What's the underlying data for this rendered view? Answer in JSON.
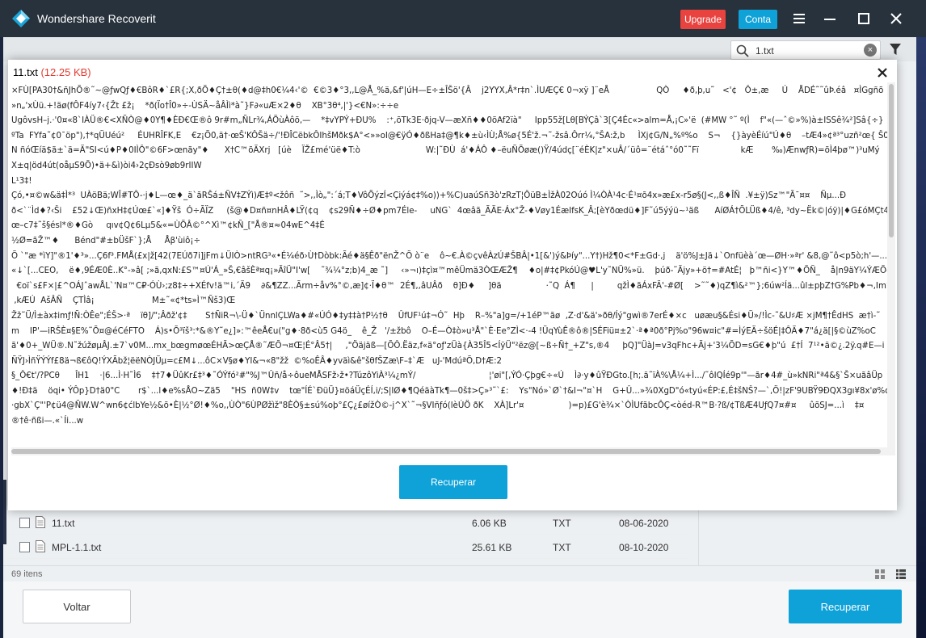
{
  "window": {
    "title": "Wondershare Recoverit",
    "upgrade_label": "Upgrade",
    "account_label": "Conta",
    "accent_blue": "#0fa2d8",
    "upgrade_red": "#e8433f"
  },
  "toolbar": {
    "search_value": "1.txt"
  },
  "preview": {
    "file_name": "11.txt",
    "file_size": "(12.25 KB)",
    "content_lines": [
      "×FÙ[PA30†&ñJhÕ®˜~@ƒwQƒ♦€BôR♦`£R{;X,ðÕ♦Ç†±θ(♦d@‡h0€¼4‹'©  €©3♦°3,,L@Å_%ä,&f'|úH—E÷±ÎŠö'{Â    j2YYX,Â*r‡n`.ÌUÆÇ€ 0¬xÿ ]¨eÅ                  QÒ     ♦ð,þ,u˜   <'¢   Ô±,æ     Ú    ÅDÉ˜˜ûÞ.éâ   ¤ÌGgñõ",
      "»n„'xÙü.+!äø(fÔF4íy7‹{Žt £ž¡    *ð(Ïo†Î0»÷-ÙSÄ~åÂÌì*à˜}F∂«uÆ×2♦θ    XB°3θ⁴,|'}<€N»:÷÷e",
      "UgôvsH–j.·'0¤«8`IÀÜ®€<XÑÒ@♦0Y¶♦ÈÐ€Œ®ô 9r#m„ÑLr¾,ÁÖùÀôõ,—    *‡vYPÝ+ÐU%    :⁺,õTk3E·ðjq-V—æXñ♦♦0õAf2ïà\"     Ipp55ž[Lθ[BÝÇâ`3[Ç4Éc«>alm=Å,¡C»'ë  (#MW °˜ º(Ì    f\"«(—ˆ©»%)à±ISSê¾²]Sâ{÷}   ÷Ý",
      "ºTa  FYfa˜¢0¯öp\"),†*qÜUéú²     ÉUHRÎFK,E    €z¡Õ0,ä†·œŠ'KÔŠä÷/'!ÐÎCëbkÔIhšMðk$A°<»»oI@€ÿÓ♦ðßHa‡@¶k♦±ù‹ÌÙ;Å%ø{5É'ž.¬˜-žsâ.Ôrr¼,°ŠA:ž,b     ÌXj¢G/N„%º%o    S¬    {}àyèÉíú\"Ú♦θ    –tÆ4»¢ª³°uzñ²œ{ Š0C¦0",
      "N ñóŒíä$ã±`ä=Ä\"SI<ú♦P♦0IÌÔ\"©6F>œnãy\"♦      X†C™õÄXrj   [úè    ÏŽ£mé'üë♦T:ò                         W:|˜ÐÙ  á'♦ÁÔ ♦–ëuÑÕøæ()Ÿ/4údç[¨éÈK|z\"×uÂ/´üô=¨étáˆ°ó0˜˜Fï                kÆ       ‰)ÆnwƒR)=õÌ4þø™)³uMý   |¥¶â",
      "X±q|öd4út(oåµS9Õ)•ä+&ì)òi4›2çÐsò9øb9rIIW",
      "L¹3‡!",
      "Çó,•¤©w&ä‡Ì*³  UÀöBä;WÎ#TÔ-·j♦L—œ♦_ä`ãRŠá±ÑV‡ZÝì)Æ‡º<žôñ  ˜>,,Ìò„\":´á;T♦VôÕýzÍ<Çiýá¢‡%o))+%C)uaúSñ3ò'zRzT¦ÔüB±ÌžÀ02Oúó Ì¼ÒÀ¹4c·É¹¤õ4x»æ£x-r5ø§(J<,,ß♦ÎÑ  .¥±ÿ)Sz™\"Ã¯¤¤    Ñµ...Ð",
      "ð<`¨Ìd♦?‹Ši    £52↓Œ)ñxH‡¢Úœ£`«]♦Ÿš  Ó÷ÃÏZ     (š@♦D¤ñ¤nHÂ♦LŸ(¢q    ¢s29Ñ♦÷Ø♦pm7Éle-     uNG`  4œâã_ÃÄE·Áx°Ž-♦Vøy1ÉæIfsK_Â;[èYðœdü♦]F˜ú5ýýü~¹äß      AíØÁ†ÕLÜß♦4/ê, ³dy~Ëk©|óÿ)|♦G£óMÇt4|  +þ",
      "œ–c7‡˜š§ésl*®♦Gò     qıv¢Q¢6Lµ5&«=ÙÕÂ©°^Xì™¢kÑ_[\"Å®¤≈04wE^4‡É",
      "½Ø=ãŽ™♦      Bénd\"#±bÜšF`};Å     Åβ'ùiô¡÷",
      "Õ `\"æ *ìY]\"®1'♦³»...Ç6f³.FMÅ(£x|ž[42(7EÚð7i]jFm↓ÜIÒ>ntRG³«•É¼éð›Ù†Dòbk:Ãé♦ä§Êð\"ënŽ^Õ ò¨e    ô~€.À©çvêÀzÚ#ŠBÂ|•1[&')ý&Þíy\"...Y†)Hž¶0<*F±Gd·,j    ä'ö%J±Jä↓`Onfüèà´œ—ØH·»ªr' &8,@˜ô<p5ò;h'—...",
      "«↓`[...CEO,    ë♦,9ÉÆ0È..K°-»â[ ;»ã,qxN:£S™¤Ú'Á_»Š,€âšÈª¤q¡»ÃîÜ\"I'w[    ˜¾¼°z;b)4_æ ˜]     ‹»¬ı)‡çì¤™mêÜmä3ÒŒÆŽ¶    ♦o|#‡¢PkóÚ@♥L'y˜NÜ%»ü.    þúð-˜Ãjy»+ö†=#AtÉ¦   þ™ñi<}Y™♦ÕÑ_    å|n9äY¼ÝÆÕ—gE€Ó7(",
      "  €oï`s£F×|£^OÁJˆawÅL`'N¤™C₽·ÓÙ›;z8‡÷+XÉfv!ä™i,´Ä9    ∂&¶ZZ...Ãrm÷åv%°©,æ]¢·Ï♦θ™  2É¶,,âUÂð    θ]Ð♦     ]θä                 ·˜Q  Á¶      |         qžÌ♦ãÁxFÄ'-#Ø[    >˜˜♦)qZ¶ì&²™};6úw²Íä...ûl±pþZ†G%Pb♦¬,Im°fo§\"   37",
      " ‚kÆÚ  AšÂÑ    ÇTÌâ¡                      M±˜«¢*ts»Ì™Ñš3)Œ",
      "Žž˜Ü/Ì±àx‡imƒ!Ñ:ÒÊe\";ÉŠ>·ª    ïθ]/\";Âðž'¢‡       S†ÑiR¬\\-Ü♦`ÜnnlÇLWa♦#«ÚÓ♦‡y‡‡à†P½†θ    ÛfUF¹ú‡¬Ó˜  Hþ    R–%\"a]g=/+1éP™ãø  ,Z·d'&ä'»ðθ/Íý\"gwì®7erÉ♦×c   uøæu§&Ési♦Ü»/!Ìc-˜&U♯Æ ×jM¶†ÊdHS  æ†ì-˜",
      "m    IP'—iRŠÈ¤§E%˜Õ¤@éCéFTO    Á)s•Õ³ïš³:*&®Y˜e¿]»:™êeÅ€u(\"g♦·8ð<ù5 G4ö_    ê_Ž   '/±žbô    O–É—Ò‡ò»u³Å\"`È·Ee°ZÌ<·-4 !ÜqYùÊ®ô®|SÉFiü¤±2`·ª♦ª0ð°Pj%o\"96w¤ic\"#=ÌýEÄ÷šöÉ|‡ÔÄ♦7\"á¿ä[|§©ùZ%oC",
      "ã'♦0+_WÜ®.N˜žúžøµÂJ.±7`v0M...mx_bœgmøœÉHÃ>œÇÅ®˜ÆÕ¬¤Œ¦É°Â5†|     ,\"Öäjäß—[ÕÔ.Ëäz,f«ä°oƒ'zÜà{À35Î5<ÍÿÜ\"²ëz@[~ß÷Ñ†_+Z\"s,®4     þQ]\"ÜàJ=v3qFhc+Ãj+'3¼ÕD=sG€♦þ\"ú  £†Í  7¹²•ä©¿.2ÿ.q#E—i",
      "ÑŸJ›ÌñŸÝÝf£8ä¬ß€ôQ!ÝXÃbž¦ëëNÒJÜµ=c£M↓...ôC×V§ø♦YI&¬«8\"žž  ©%oÊÂ♦yväì&ê\"šθfŠZæ\\F–‡`Æ   uJ-'MdúªÕ,D†Æ:2",
      "§_Ô€t'/?PCθ      ÎH1    ·|6...Ì·H˜Ì6    ‡†7♦ÜûKr£‡³♦˜ÓÝfó²#\"%J™Ûñ/å÷ôueMÅSFž›ž•?TúzôYiÀ³¼¿mÝ/                            ¦'øi\"[,ÝÓ·Çþg€÷«Ú    Ì∂·y♦ûŸÐGto.[h;.ä˜ïÀ%\\Å¼+Ì.../˜ôIQÍé9p'\"—ãr♦4#_ù»kNRi\"ª4&§`Š×uãâÜp",
      "♦!Ð‡ä    öqi• ÝÔp}D†ä0\"C       r$`...l♦e%sÅO~Zä5    \"HS  ñ0W‡v    tœ\"ÍÉ`ÐüÜ}¤öáÜçÉÍ,i/;S|IØ♦¶QéäàTk¶—0š‡>Ç»³˜`£:    Ys\"Nó»`Ø`†&I¬\"¤`H    G+Û...»¾0XgD\"ó«tyú«ÉP:£,É‡šNŠ?—`,Ö!|zF'9UBŸ9ÐQX3gı¥8x'ø%oc",
      "·gbX`Ç\"'P¢ü4@ÑW.W^wn6¢ćlbYe½&õ•È|½°Ø!♦%o,,ÙÒ\"6ÙPØžìž\"8ÈÒ§±sú%oþ°£Ç¿£øížÒ©-j^X`˜¬§VIñƒó(lèÚÖ ðK    XÀ]Lr'¤                 )=p)£G'è¾×`ÒÌUfãbcÔÇ<òéd-R™B·?ß/¢TßÆ4UƒQ7¤#¤     ûõSJ=...ì    ‡¤",
      "®†ê·ñßi—.«`Íi...w"
    ],
    "recover_label": "Recuperar"
  },
  "file_list": {
    "rows": [
      {
        "name": "11.txt",
        "size": "6.06 KB",
        "type": "TXT",
        "date": "08-06-2020"
      },
      {
        "name": "MPL-1.1.txt",
        "size": "25.61 KB",
        "type": "TXT",
        "date": "08-10-2020"
      }
    ]
  },
  "status": {
    "items_count": "69 itens"
  },
  "footer": {
    "back_label": "Voltar",
    "recover_label": "Recuperar"
  }
}
